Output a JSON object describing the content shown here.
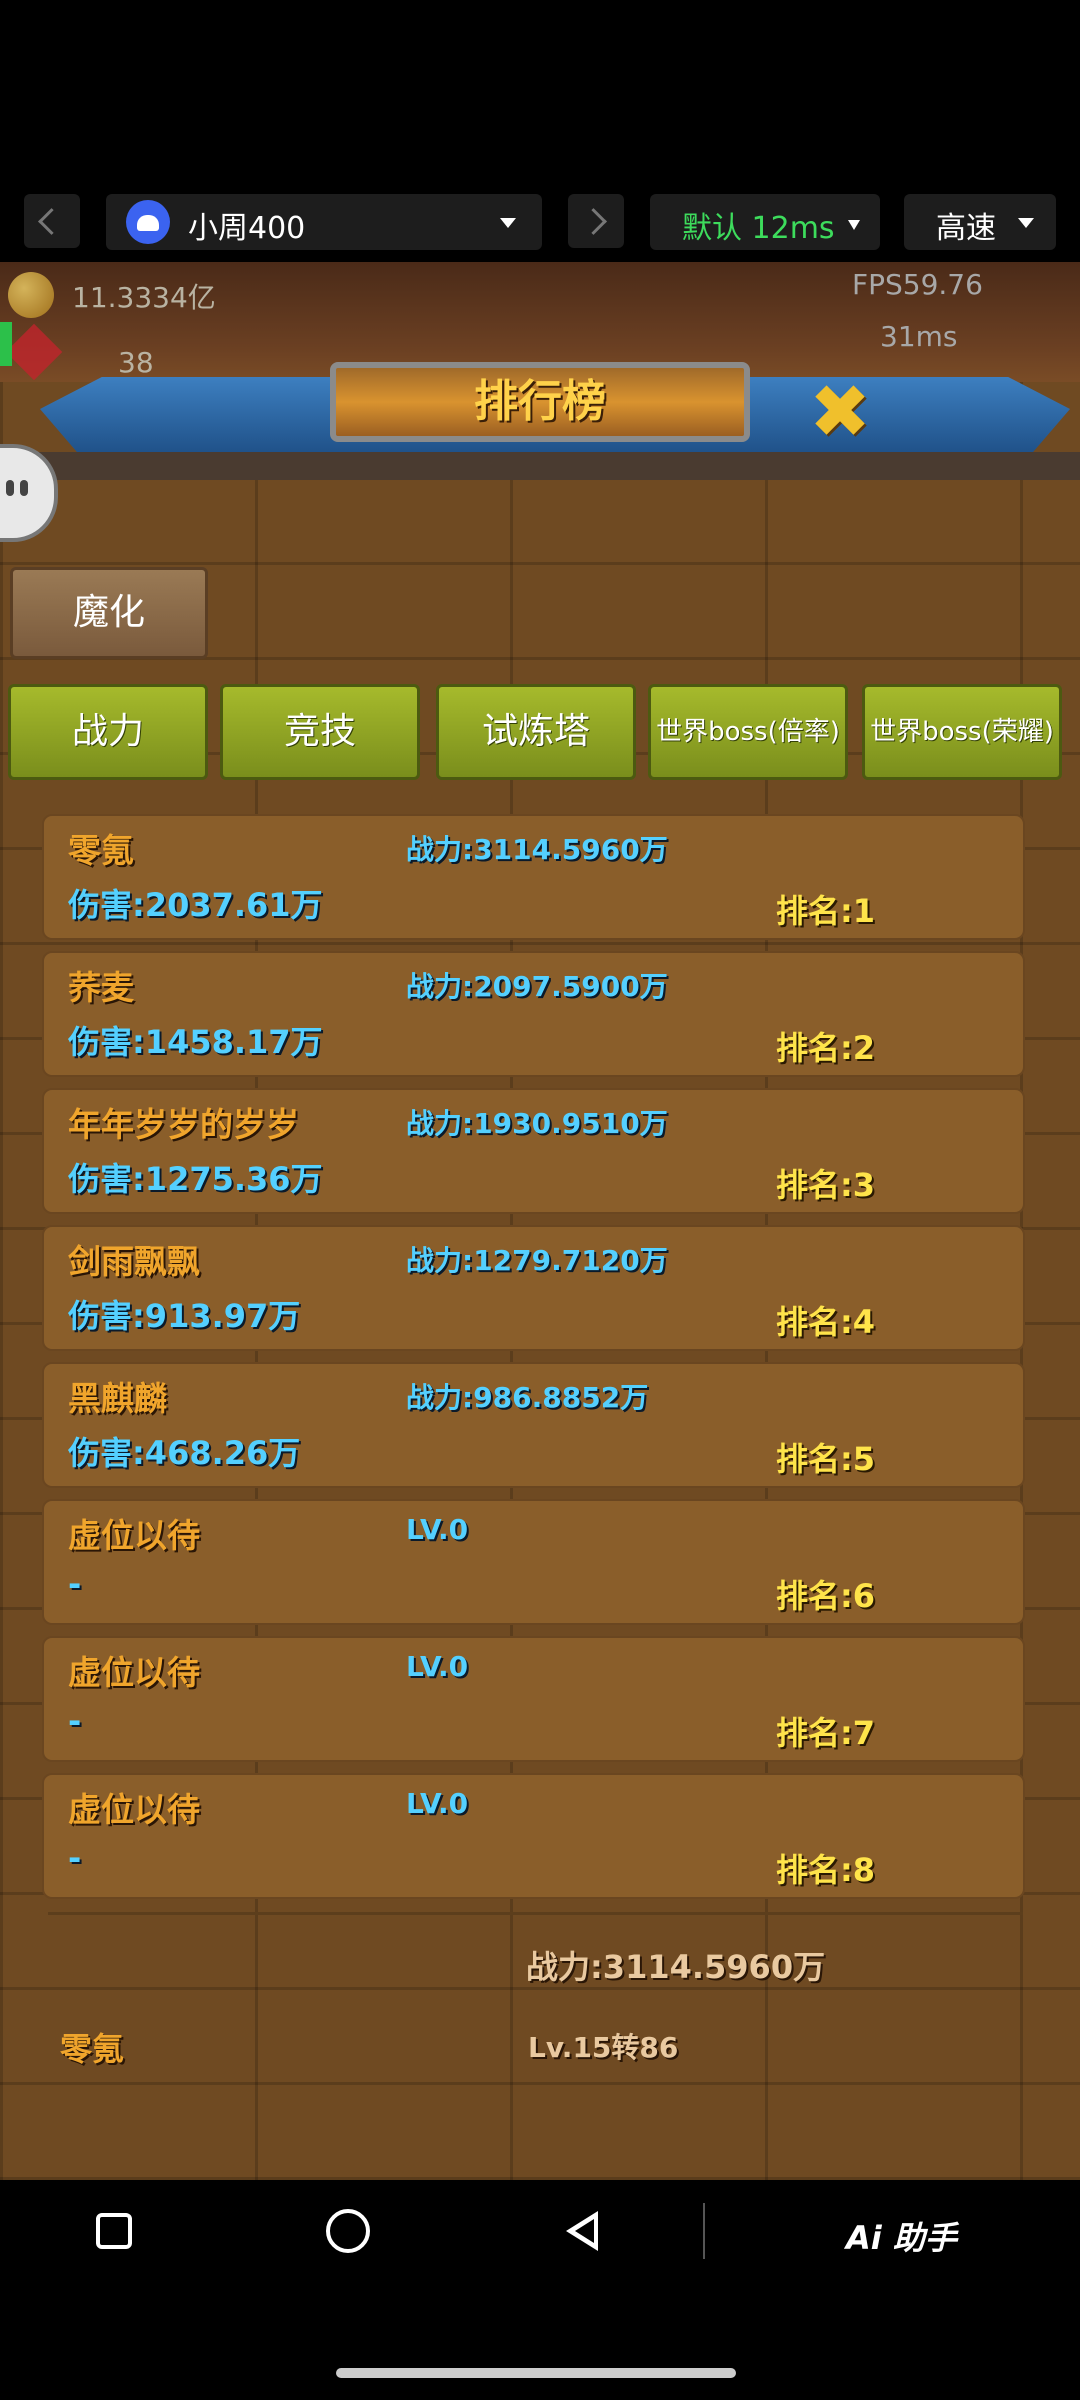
{
  "topbar": {
    "device_name": "小周400",
    "line_label": "默认 12ms",
    "speed_label": "高速",
    "accent_green": "#3ddc5c"
  },
  "hud": {
    "gold": "11.3334亿",
    "gems": "38",
    "fps": "FPS59.76",
    "ping": "31ms"
  },
  "title": "排行榜",
  "category_button": "魔化",
  "tabs": [
    "战力",
    "竞技",
    "试炼塔",
    "世界boss(倍率)",
    "世界boss(荣耀)"
  ],
  "rows": [
    {
      "name": "零氪",
      "power": "战力:3114.5960万",
      "damage": "伤害:2037.61万",
      "rank": "排名:1"
    },
    {
      "name": "荞麦",
      "power": "战力:2097.5900万",
      "damage": "伤害:1458.17万",
      "rank": "排名:2"
    },
    {
      "name": "年年岁岁的岁岁",
      "power": "战力:1930.9510万",
      "damage": "伤害:1275.36万",
      "rank": "排名:3"
    },
    {
      "name": "剑雨飘飘",
      "power": "战力:1279.7120万",
      "damage": "伤害:913.97万",
      "rank": "排名:4"
    },
    {
      "name": "黑麒麟",
      "power": "战力:986.8852万",
      "damage": "伤害:468.26万",
      "rank": "排名:5"
    },
    {
      "name": "虚位以待",
      "power": "LV.0",
      "damage": "-",
      "rank": "排名:6"
    },
    {
      "name": "虚位以待",
      "power": "LV.0",
      "damage": "-",
      "rank": "排名:7"
    },
    {
      "name": "虚位以待",
      "power": "LV.0",
      "damage": "-",
      "rank": "排名:8"
    }
  ],
  "my": {
    "power": "战力:3114.5960万",
    "name": "零氪",
    "level": "Lv.15转86"
  },
  "navbar": {
    "ai_label": "Ai 助手"
  }
}
